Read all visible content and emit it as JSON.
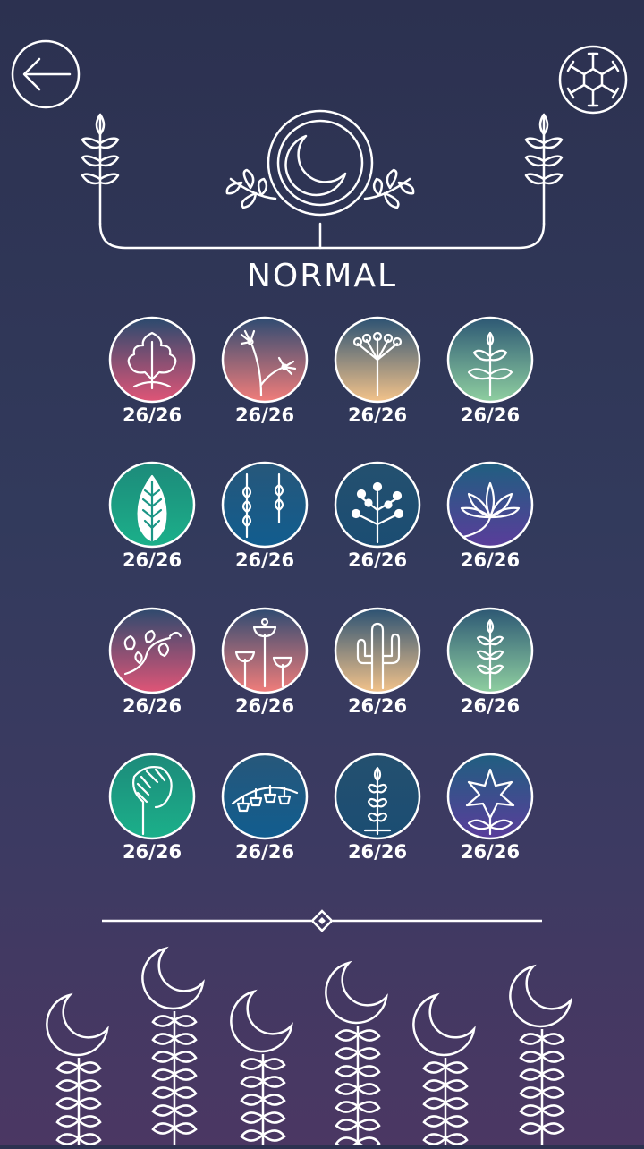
{
  "header": {
    "back_icon": "arrow-left-icon",
    "settings_icon": "hexagon-gear-icon",
    "emblem_icon": "crescent-moon-icon"
  },
  "difficulty": "NORMAL",
  "levels": [
    {
      "icon": "oak-leaf-icon",
      "score": "26/26",
      "colors": [
        "#2a4a6e",
        "#e05577"
      ]
    },
    {
      "icon": "dandelion-icon",
      "score": "26/26",
      "colors": [
        "#2f4b72",
        "#f27d7a"
      ]
    },
    {
      "icon": "umbel-flower-icon",
      "score": "26/26",
      "colors": [
        "#2c5273",
        "#f4c38a"
      ]
    },
    {
      "icon": "branch-leaves-icon",
      "score": "26/26",
      "colors": [
        "#2d5874",
        "#8fcfa0"
      ]
    },
    {
      "icon": "fern-leaf-icon",
      "score": "26/26",
      "colors": [
        "#1d8a7a",
        "#1bb08a"
      ]
    },
    {
      "icon": "wisteria-icon",
      "score": "26/26",
      "colors": [
        "#27577a",
        "#115d8f"
      ]
    },
    {
      "icon": "berry-branch-icon",
      "score": "26/26",
      "colors": [
        "#24506f",
        "#1b4d73"
      ]
    },
    {
      "icon": "lotus-icon",
      "score": "26/26",
      "colors": [
        "#205f80",
        "#5a3d9b"
      ]
    },
    {
      "icon": "ivy-vine-icon",
      "score": "26/26",
      "colors": [
        "#2e4a6e",
        "#e05577"
      ]
    },
    {
      "icon": "tulip-cups-icon",
      "score": "26/26",
      "colors": [
        "#2f4b72",
        "#f27d7a"
      ]
    },
    {
      "icon": "cactus-icon",
      "score": "26/26",
      "colors": [
        "#2c5273",
        "#f4c38a"
      ]
    },
    {
      "icon": "wheat-sprig-icon",
      "score": "26/26",
      "colors": [
        "#2d5874",
        "#8fcfa0"
      ]
    },
    {
      "icon": "striped-leaf-icon",
      "score": "26/26",
      "colors": [
        "#1d8a7a",
        "#1bb08a"
      ]
    },
    {
      "icon": "bellflower-icon",
      "score": "26/26",
      "colors": [
        "#27577a",
        "#115d8f"
      ]
    },
    {
      "icon": "grain-stalk-icon",
      "score": "26/26",
      "colors": [
        "#24506f",
        "#1b4d73"
      ]
    },
    {
      "icon": "star-flower-icon",
      "score": "26/26",
      "colors": [
        "#205f80",
        "#5a3d9b"
      ]
    }
  ]
}
